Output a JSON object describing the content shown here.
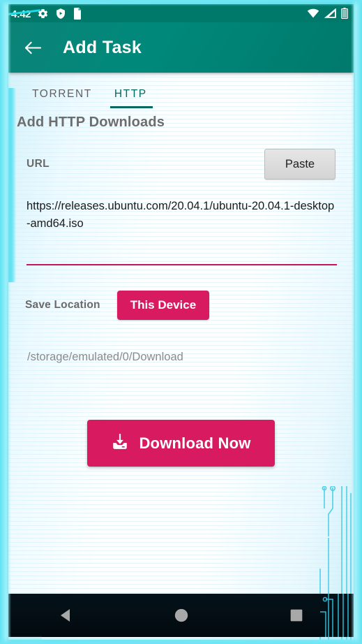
{
  "statusbar": {
    "time": "4:42",
    "icons_left": [
      "settings-gear-icon",
      "shield-play-icon",
      "sd-card-icon"
    ],
    "icons_right": [
      "wifi-icon",
      "cell-signal-icon",
      "battery-icon"
    ]
  },
  "appbar": {
    "back_icon": "back-arrow-icon",
    "title": "Add Task",
    "background_color": "#00796b"
  },
  "tabs": [
    {
      "label": "TORRENT",
      "active": false
    },
    {
      "label": "HTTP",
      "active": true
    }
  ],
  "section": {
    "title": "Add HTTP Downloads"
  },
  "url_field": {
    "label": "URL",
    "paste_label": "Paste",
    "value": "https://releases.ubuntu.com/20.04.1/ubuntu-20.04.1-desktop-amd64.iso",
    "underline_color": "#c2185b"
  },
  "save_location": {
    "label": "Save Location",
    "selected_target": "This Device",
    "path": "/storage/emulated/0/Download",
    "accent_color": "#d81b60"
  },
  "download": {
    "icon": "download-tray-icon",
    "label": "Download Now",
    "background_color": "#d81b60"
  },
  "navbar": {
    "back": "nav-back-triangle-icon",
    "home": "nav-home-circle-icon",
    "recents": "nav-recents-square-icon"
  },
  "theme": {
    "frame_accent": "#5fe2f2",
    "primary": "#00796b",
    "tab_active": "#00695c"
  }
}
